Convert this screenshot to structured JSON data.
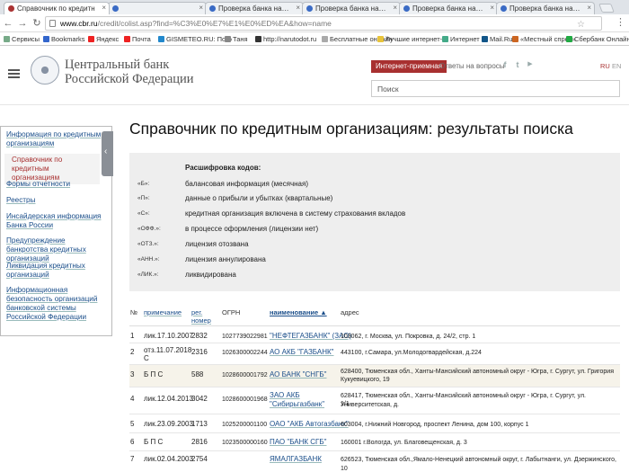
{
  "browser": {
    "tabs": [
      {
        "label": "Справочник по кредитн"
      },
      {
        "label": ""
      },
      {
        "label": "Проверка банка на отз"
      },
      {
        "label": "Проверка банка на отз"
      },
      {
        "label": "Проверка банка на отз"
      },
      {
        "label": "Проверка банка на отз"
      }
    ],
    "url_host": "www.cbr.ru",
    "url_path": "/credit/colist.asp?find=%C3%E0%E7%E1%E0%ED%EA&how=name",
    "bookmarks": [
      "Сервисы",
      "Bookmarks",
      "Яндекс",
      "Почта",
      "GISMETEO.RU: Пого",
      "Таня",
      "http://narutodot.ru",
      "Бесплатные онлайн",
      "Лучшие интернет-м",
      "Интернет",
      "Mail.Ru",
      "«Местный спрос»",
      "Сбербанк Онлайн"
    ]
  },
  "header": {
    "bank_line1": "Центральный банк",
    "bank_line2": "Российской Федерации",
    "reception": "Интернет-приемная",
    "answers": "Ответы на вопросы",
    "lang_ru": "RU",
    "lang_en": "EN",
    "search_placeholder": "Поиск",
    "social": {
      "fb": "f",
      "tw": "t",
      "yt": "▶"
    }
  },
  "sidebar": {
    "items": [
      "Информация по кредитным организациям",
      "Справочник по кредитным организациям",
      "Формы отчетности",
      "Реестры",
      "Инсайдерская информация Банка России",
      "Предупреждение банкротства кредитных организаций",
      "Ликвидация кредитных организаций",
      "Информационная безопасность организаций банковской системы Российской Федерации"
    ]
  },
  "page": {
    "title": "Справочник по кредитным организациям: результаты поиска"
  },
  "legend": {
    "title": "Расшифровка кодов:",
    "items": [
      {
        "code": "«Б»:",
        "desc": "балансовая информация (месячная)"
      },
      {
        "code": "«П»:",
        "desc": "данные о прибыли и убытках (квартальные)"
      },
      {
        "code": "«С»:",
        "desc": "кредитная организация включена в систему страхования вкладов"
      },
      {
        "code": "«ОФФ.»:",
        "desc": "в процессе оформления (лицензии нет)"
      },
      {
        "code": "«ОТЗ.»:",
        "desc": "лицензия отозвана"
      },
      {
        "code": "«АНН.»:",
        "desc": "лицензия аннулирована"
      },
      {
        "code": "«ЛИК.»:",
        "desc": "ликвидирована"
      }
    ]
  },
  "table": {
    "headers": {
      "num": "№",
      "note": "примечание",
      "reg1": "рег.",
      "reg2": "номер",
      "ogrn": "ОГРН",
      "name": "наименование ▲",
      "address": "адрес"
    },
    "rows": [
      {
        "num": "1",
        "note": "лик.17.10.2007",
        "note2": "",
        "reg": "2832",
        "ogrn": "1027739022981",
        "name": "\"НЕФТЕГАЗБАНК\" (ЗАО)",
        "name2": "",
        "addr": "103062, г. Москва, ул. Покровка, д. 24/2, стр. 1",
        "addr2": ""
      },
      {
        "num": "2",
        "note": "отз.11.07.2018",
        "note2": "С",
        "reg": "2316",
        "ogrn": "1026300002244",
        "name": "АО АКБ \"ГАЗБАНК\"",
        "name2": "",
        "addr": "443100, г.Самара, ул.Молодогвардейская, д.224",
        "addr2": ""
      },
      {
        "num": "3",
        "note": "Б П С",
        "note2": "",
        "reg": "588",
        "ogrn": "1028600001792",
        "name": "АО БАНК \"СНГБ\"",
        "name2": "",
        "addr": "628400, Тюменская обл., Ханты-Мансийский автономный округ - Югра, г. Сургут, ул. Григория",
        "addr2": "Кукуевицкого, 19"
      },
      {
        "num": "4",
        "note": "лик.12.04.2013",
        "note2": "",
        "reg": "3042",
        "ogrn": "1028600001968",
        "name": "ЗАО АКБ",
        "name2": "\"Сибирьгазбанк\"",
        "addr": "628417, Тюменская обл., Ханты-Мансийский автономный округ - Югра, г. Сургут, ул. Университетская, д.",
        "addr2": "1/1"
      },
      {
        "num": "5",
        "note": "лик.23.09.2003",
        "note2": "",
        "reg": "1713",
        "ogrn": "1025200001100",
        "name": "ОАО \"АКБ Автогазбанк\"",
        "name2": "",
        "addr": "603004, г.Нижний Новгород, проспект Ленина, дом 100, корпус 1",
        "addr2": ""
      },
      {
        "num": "6",
        "note": "Б П С",
        "note2": "",
        "reg": "2816",
        "ogrn": "1023500000160",
        "name": "ПАО \"БАНК СГБ\"",
        "name2": "",
        "addr": "160001 г.Вологда, ул. Благовещенская, д. 3",
        "addr2": ""
      },
      {
        "num": "7",
        "note": "лик.02.04.2003",
        "note2": "",
        "reg": "2754",
        "ogrn": "",
        "name": "ЯМАЛГАЗБАНК",
        "name2": "",
        "addr": "626523, Тюменская обл.,Ямало-Ненецкий автономный округ, г. Лабытнанги, ул. Дзержинского, 10",
        "addr2": ""
      }
    ]
  }
}
